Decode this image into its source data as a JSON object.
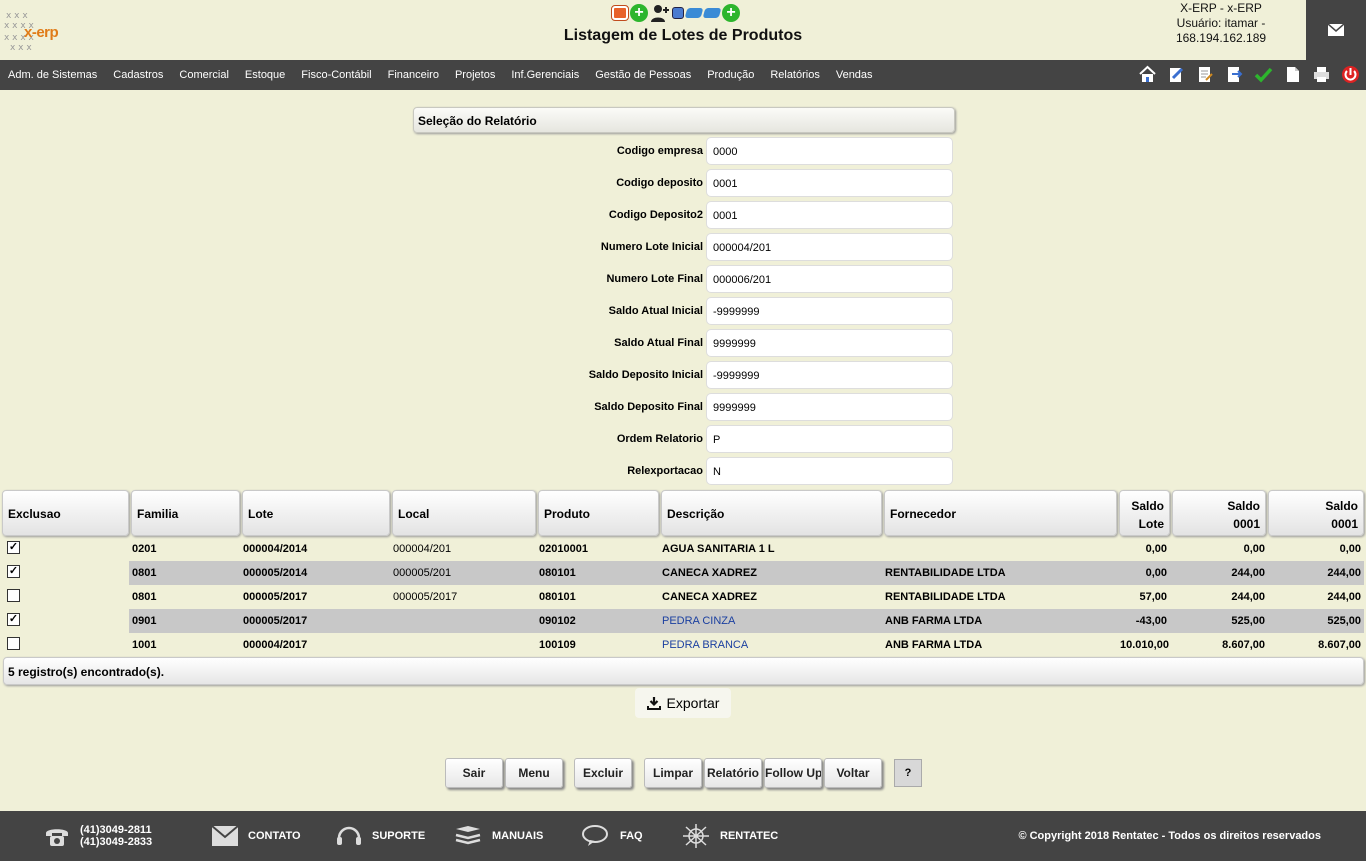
{
  "app": {
    "logo_text": "x-erp",
    "title": "Listagem de Lotes de Produtos",
    "user_lines": [
      "X-ERP - x-ERP",
      "Usuário: itamar -",
      "168.194.162.189"
    ]
  },
  "menu": [
    "Adm. de Sistemas",
    "Cadastros",
    "Comercial",
    "Estoque",
    "Fisco-Contábil",
    "Financeiro",
    "Projetos",
    "Inf.Gerenciais",
    "Gestão de Pessoas",
    "Produção",
    "Relatórios",
    "Vendas"
  ],
  "selection": {
    "header": "Seleção do Relatório",
    "fields": [
      {
        "label": "Codigo empresa",
        "value": "0000"
      },
      {
        "label": "Codigo deposito",
        "value": "0001"
      },
      {
        "label": "Codigo Deposito2",
        "value": "0001"
      },
      {
        "label": "Numero Lote Inicial",
        "value": "000004/201"
      },
      {
        "label": "Numero Lote Final",
        "value": "000006/201"
      },
      {
        "label": "Saldo Atual Inicial",
        "value": "-9999999"
      },
      {
        "label": "Saldo Atual Final",
        "value": "9999999"
      },
      {
        "label": "Saldo Deposito Inicial",
        "value": "-9999999"
      },
      {
        "label": "Saldo Deposito Final",
        "value": "9999999"
      },
      {
        "label": "Ordem Relatorio",
        "value": "P"
      },
      {
        "label": "Relexportacao",
        "value": "N"
      }
    ]
  },
  "table": {
    "headers": {
      "exclusao": "Exclusao",
      "familia": "Familia",
      "lote": "Lote",
      "local": "Local",
      "produto": "Produto",
      "descricao": "Descrição",
      "fornecedor": "Fornecedor",
      "saldo_lote_1": "Saldo",
      "saldo_lote_2": "Lote",
      "saldo_a_1": "Saldo",
      "saldo_a_2": "0001",
      "saldo_b_1": "Saldo",
      "saldo_b_2": "0001"
    },
    "rows": [
      {
        "checked": true,
        "checkmark": "✓",
        "familia": "0201",
        "lote": "000004/2014",
        "local": "000004/201",
        "produto": "02010001",
        "descricao": "AGUA SANITARIA 1 L",
        "fornecedor": "",
        "saldo_lote": "0,00",
        "saldo_a": "0,00",
        "saldo_b": "0,00"
      },
      {
        "checked": true,
        "checkmark": "✓",
        "familia": "0801",
        "lote": "000005/2014",
        "local": "000005/201",
        "produto": "080101",
        "descricao": "CANECA XADREZ",
        "fornecedor": "RENTABILIDADE LTDA",
        "saldo_lote": "0,00",
        "saldo_a": "244,00",
        "saldo_b": "244,00"
      },
      {
        "checked": false,
        "checkmark": "",
        "familia": "0801",
        "lote": "000005/2017",
        "local": "000005/2017",
        "produto": "080101",
        "descricao": "CANECA XADREZ",
        "fornecedor": "RENTABILIDADE LTDA",
        "saldo_lote": "57,00",
        "saldo_a": "244,00",
        "saldo_b": "244,00"
      },
      {
        "checked": true,
        "checkmark": "✓",
        "familia": "0901",
        "lote": "000005/2017",
        "local": "",
        "produto": "090102",
        "descricao": "PEDRA CINZA",
        "fornecedor": "ANB FARMA LTDA",
        "saldo_lote": "-43,00",
        "saldo_a": "525,00",
        "saldo_b": "525,00"
      },
      {
        "checked": false,
        "checkmark": "",
        "familia": "1001",
        "lote": "000004/2017",
        "local": "",
        "produto": "100109",
        "descricao": "PEDRA BRANCA",
        "fornecedor": "ANB FARMA LTDA",
        "saldo_lote": "10.010,00",
        "saldo_a": "8.607,00",
        "saldo_b": "8.607,00"
      }
    ],
    "count_text": "5 registro(s) encontrado(s)."
  },
  "export_label": "Exportar",
  "buttons": {
    "sair": "Sair",
    "menu": "Menu",
    "excluir": "Excluir",
    "limpar": "Limpar",
    "relatorio": "Relatório",
    "followup": "Follow Up",
    "voltar": "Voltar",
    "help": "?"
  },
  "footer": {
    "phone1": "(41)3049-2811",
    "phone2": "(41)3049-2833",
    "contato": "CONTATO",
    "suporte": "SUPORTE",
    "manuais": "MANUAIS",
    "faq": "FAQ",
    "rentatec": "RENTATEC",
    "copyright": "© Copyright 2018 Rentatec - Todos os direitos reservados"
  },
  "colors": {
    "background": "#f0f0d8",
    "bar": "#444444",
    "shade": "#c8c8c8",
    "link": "#1a3fa0",
    "green": "#2db52d"
  }
}
